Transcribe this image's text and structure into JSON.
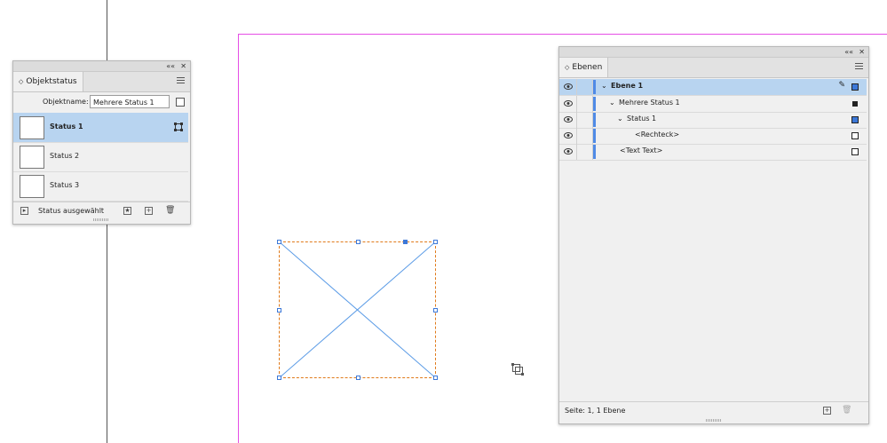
{
  "object_states_panel": {
    "collapse_label": "««",
    "close_label": "✕",
    "tab_title": "Objektstatus",
    "object_name_label": "Objektname:",
    "object_name_value": "Mehrere Status 1",
    "states": [
      {
        "label": "Status 1",
        "selected": true
      },
      {
        "label": "Status 2",
        "selected": false
      },
      {
        "label": "Status 3",
        "selected": false
      }
    ],
    "footer_status": "Status ausgewählt"
  },
  "layers_panel": {
    "collapse_label": "««",
    "close_label": "✕",
    "tab_title": "Ebenen",
    "rows": [
      {
        "label": "Ebene 1",
        "indent": 0,
        "selected": true,
        "expanded": true
      },
      {
        "label": "Mehrere Status 1",
        "indent": 1,
        "selected": false,
        "expanded": true
      },
      {
        "label": "Status 1",
        "indent": 2,
        "selected": false,
        "expanded": true
      },
      {
        "label": "<Rechteck>",
        "indent": 3,
        "selected": false
      },
      {
        "label": "<Text Text>",
        "indent": 1,
        "selected": false
      }
    ],
    "footer_status": "Seite: 1, 1 Ebene"
  },
  "colors": {
    "selection": "#b8d4f0",
    "layer_color": "#4f8ae6",
    "page_edge": "#e64ee6",
    "frame_border": "#e07a1a"
  }
}
